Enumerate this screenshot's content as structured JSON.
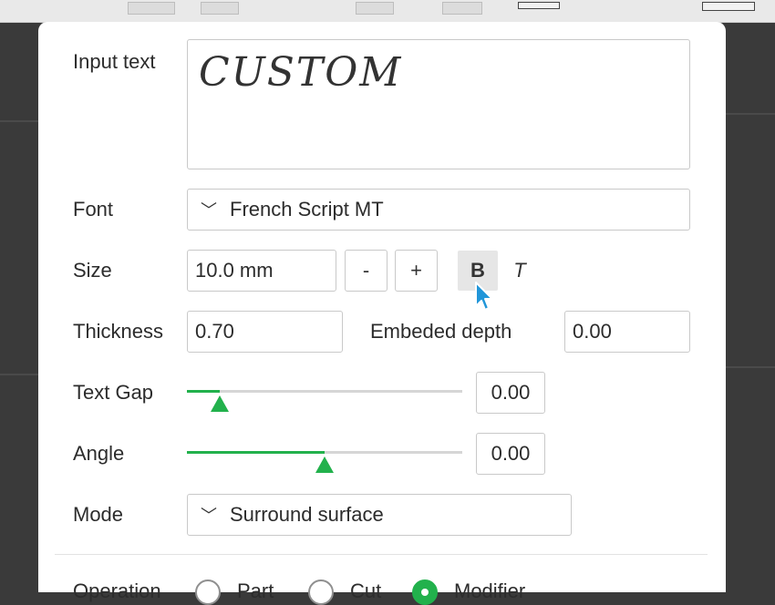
{
  "form": {
    "input_text_label": "Input text",
    "input_text_value": "CUSTOM",
    "font_label": "Font",
    "font_value": "French Script MT",
    "size_label": "Size",
    "size_value": "10.0 mm",
    "size_minus": "-",
    "size_plus": "+",
    "bold_label": "B",
    "italic_label": "T",
    "thickness_label": "Thickness",
    "thickness_value": "0.70",
    "embedded_depth_label": "Embeded depth",
    "embedded_depth_value": "0.00",
    "text_gap_label": "Text Gap",
    "text_gap_value": "0.00",
    "text_gap_slider": 0.12,
    "angle_label": "Angle",
    "angle_value": "0.00",
    "angle_slider": 0.5,
    "mode_label": "Mode",
    "mode_value": "Surround surface",
    "operation_label": "Operation",
    "operation_options": [
      "Part",
      "Cut",
      "Modifier"
    ],
    "operation_selected": "Modifier"
  },
  "colors": {
    "accent": "#22b14c",
    "panel_bg": "#ffffff",
    "canvas_bg": "#3a3a3a"
  },
  "icons": [
    "chevron-down-icon",
    "cursor-icon"
  ]
}
